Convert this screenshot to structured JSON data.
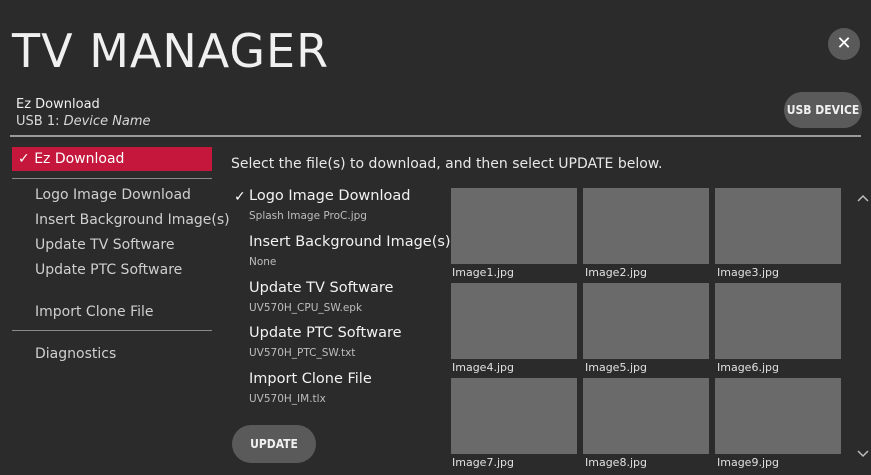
{
  "app": {
    "title": "TV MANAGER",
    "close_glyph": "✕"
  },
  "device": {
    "mode_label": "Ez Download",
    "usb_prefix": "USB 1:",
    "device_name": "Device Name",
    "usb_button_label": "USB DEVICE"
  },
  "sidebar": {
    "active_label": "Ez Download",
    "items": [
      "Logo Image Download",
      "Insert Background Image(s)",
      "Update TV Software",
      "Update PTC Software",
      "Import Clone File",
      "Diagnostics"
    ]
  },
  "main": {
    "instruction": "Select the file(s) to download, and then select UPDATE below.",
    "files": [
      {
        "title": "Logo Image Download",
        "file": "Splash Image ProC.jpg",
        "checked": true
      },
      {
        "title": "Insert Background Image(s)",
        "file": "None",
        "checked": false
      },
      {
        "title": "Update TV Software",
        "file": "UV570H_CPU_SW.epk",
        "checked": false
      },
      {
        "title": "Update PTC Software",
        "file": "UV570H_PTC_SW.txt",
        "checked": false
      },
      {
        "title": "Import Clone File",
        "file": "UV570H_IM.tlx",
        "checked": false
      }
    ],
    "update_label": "UPDATE",
    "images": [
      "Image1.jpg",
      "Image2.jpg",
      "Image3.jpg",
      "Image4.jpg",
      "Image5.jpg",
      "Image6.jpg",
      "Image7.jpg",
      "Image8.jpg",
      "Image9.jpg"
    ]
  },
  "colors": {
    "accent": "#c4173b",
    "background": "#2b2b2b",
    "thumbnail": "#6a6a6a",
    "button": "#5a5a5a"
  },
  "icons": {
    "check": "checkmark-icon",
    "close": "close-icon",
    "scroll_up": "chevron-up-icon",
    "scroll_down": "chevron-down-icon"
  }
}
